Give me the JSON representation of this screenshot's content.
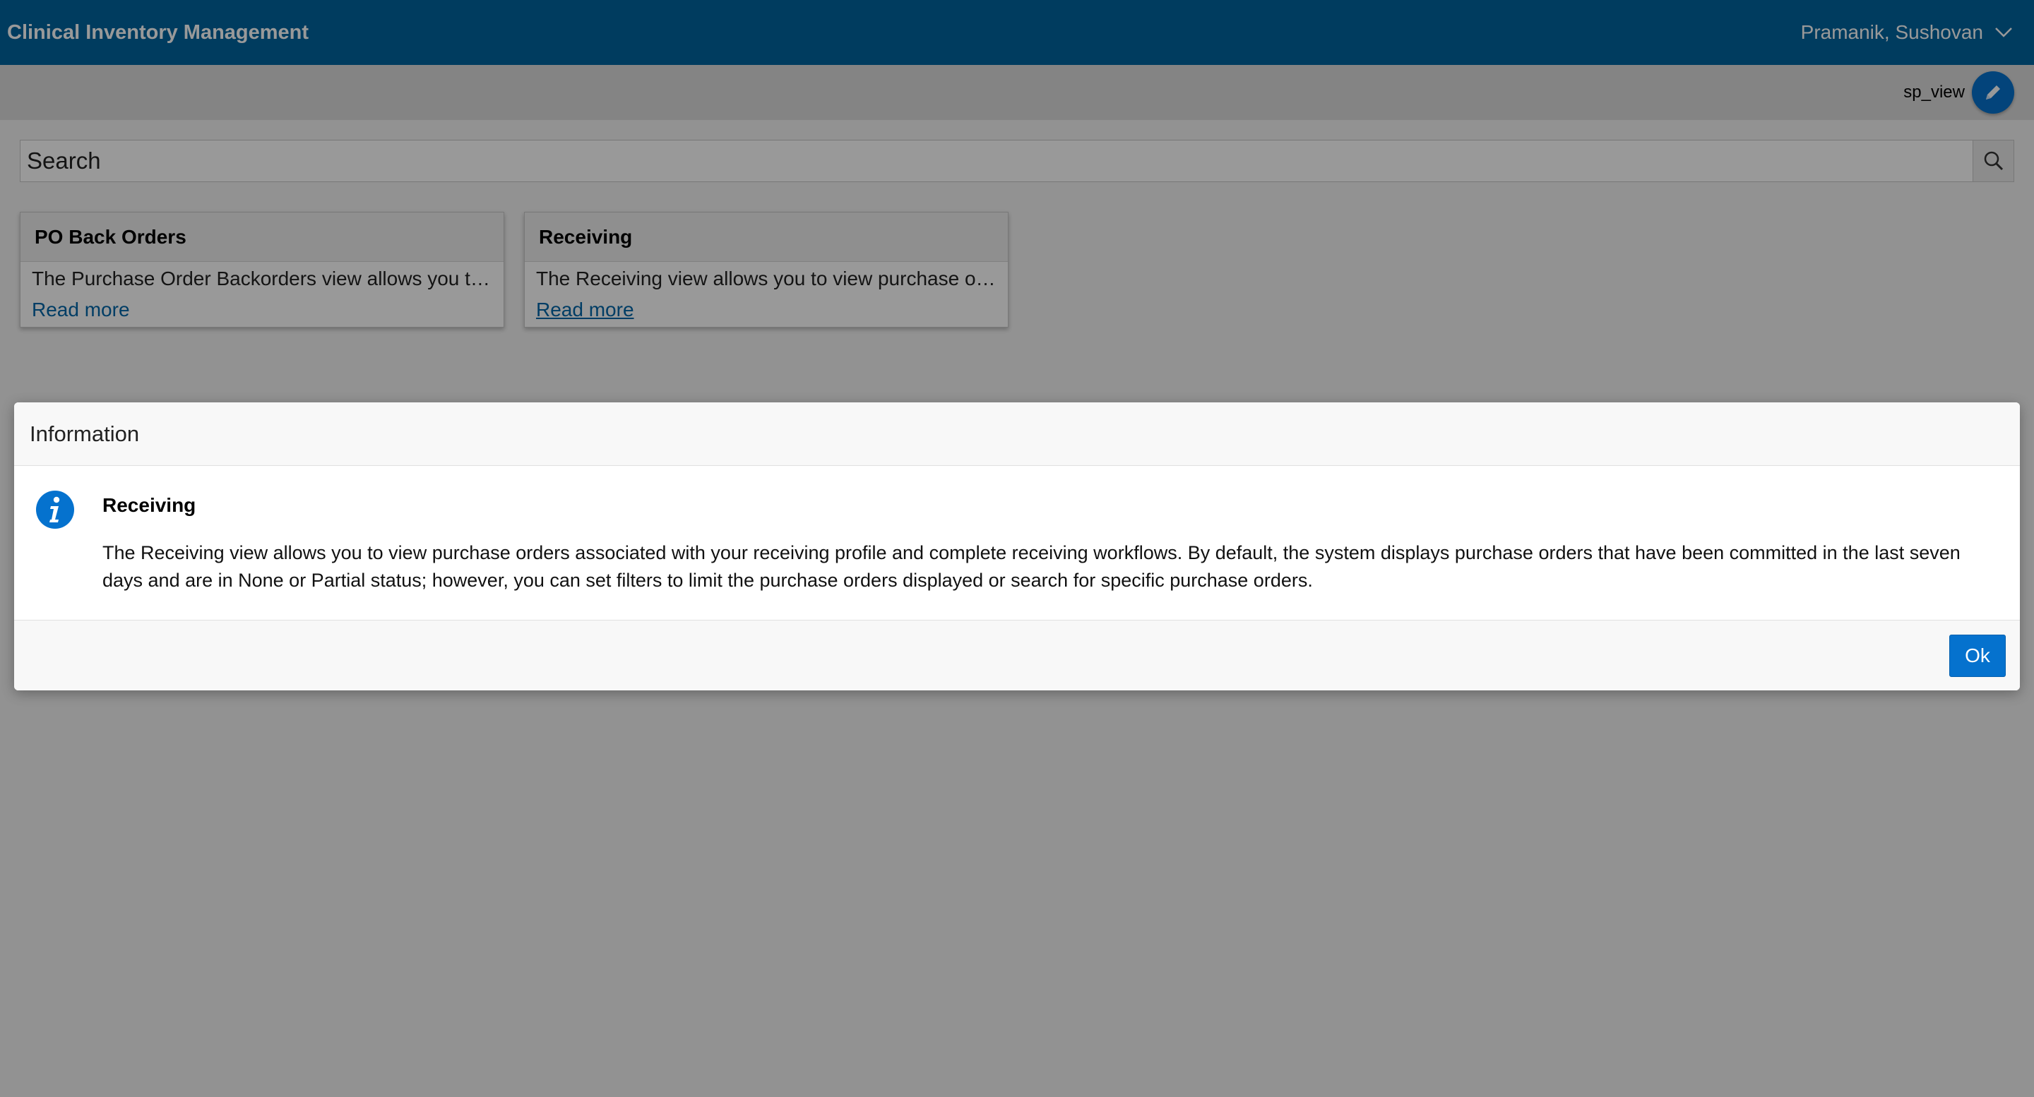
{
  "header": {
    "app_title": "Clinical Inventory Management",
    "user_name": "Pramanik, Sushovan"
  },
  "subbar": {
    "view_name": "sp_view"
  },
  "search": {
    "placeholder": "Search"
  },
  "tiles": [
    {
      "title": "PO Back Orders",
      "description": "The Purchase Order Backorders view allows you to view purchase orders",
      "link": "Read more"
    },
    {
      "title": "Receiving",
      "description": "The Receiving view allows you to view purchase orders associated with your receiving profile",
      "link": "Read more"
    }
  ],
  "dialog": {
    "title": "Information",
    "message_title": "Receiving",
    "message_text": "The Receiving view allows you to view purchase orders associated with your receiving profile and complete receiving workflows. By default, the system displays purchase orders that have been committed in the last seven days and are in None or Partial status; however, you can set filters to limit the purchase orders displayed or search for specific purchase orders.",
    "ok_label": "Ok"
  },
  "icons": {
    "user_menu": "chevron-down-icon",
    "edit": "pencil-icon",
    "search": "search-icon",
    "info": "info-icon"
  },
  "colors": {
    "brand": "#00659f",
    "accent": "#0572ce",
    "link": "#0066a8"
  }
}
